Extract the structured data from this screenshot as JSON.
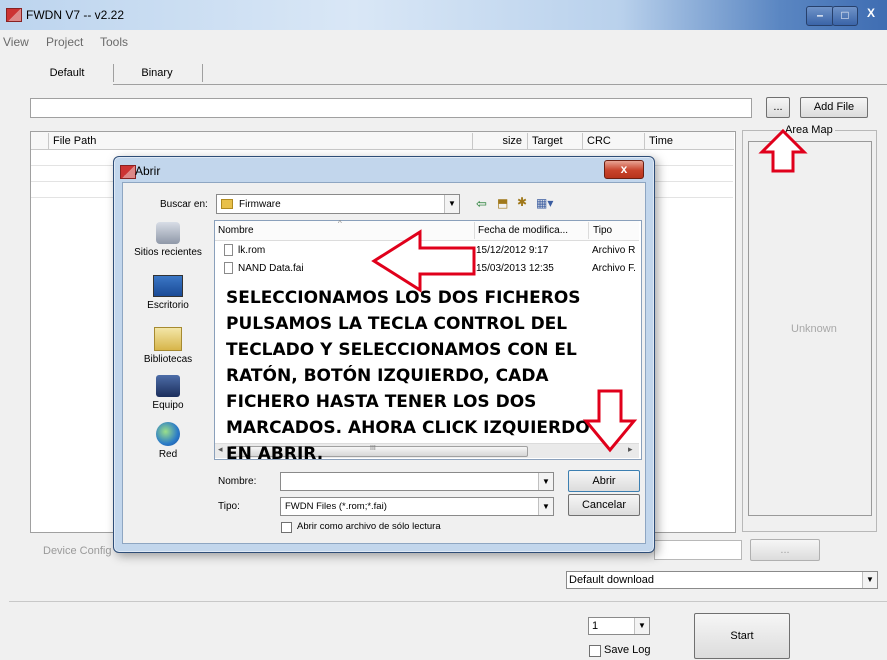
{
  "window": {
    "title": "FWDN V7 -- v2.22",
    "min": "–",
    "max": "□",
    "close": "X"
  },
  "menu": [
    "View",
    "Project",
    "Tools"
  ],
  "tabs": [
    {
      "label": "Default"
    },
    {
      "label": "Binary"
    }
  ],
  "toolbar": {
    "browse_label": "...",
    "add_file_label": "Add File"
  },
  "table": {
    "columns": [
      "File Path",
      "size",
      "Target",
      "CRC",
      "Time"
    ]
  },
  "area_map": {
    "title": "Area Map",
    "status": "Unknown"
  },
  "device_config": {
    "label": "Device Config",
    "button": "..."
  },
  "download_mode": {
    "value": "Default download"
  },
  "bottom": {
    "count": "1",
    "save_log": "Save Log",
    "start": "Start"
  },
  "dialog": {
    "title": "Abrir",
    "close": "x",
    "look_in_label": "Buscar en:",
    "look_in_value": "Firmware",
    "places": [
      {
        "label": "Sitios recientes",
        "icon": "recent-places-icon"
      },
      {
        "label": "Escritorio",
        "icon": "desktop-icon"
      },
      {
        "label": "Bibliotecas",
        "icon": "libraries-icon"
      },
      {
        "label": "Equipo",
        "icon": "computer-icon"
      },
      {
        "label": "Red",
        "icon": "network-icon"
      }
    ],
    "columns": [
      "Nombre",
      "Fecha de modifica...",
      "Tipo"
    ],
    "files": [
      {
        "name": "lk.rom",
        "date": "15/12/2012 9:17",
        "type": "Archivo R"
      },
      {
        "name": "NAND Data.fai",
        "date": "15/03/2013 12:35",
        "type": "Archivo F."
      }
    ],
    "filename_label": "Nombre:",
    "filetype_label": "Tipo:",
    "filetype_value": "FWDN Files (*.rom;*.fai)",
    "readonly_label": "Abrir como archivo de sólo lectura",
    "open_button": "Abrir",
    "cancel_button": "Cancelar",
    "scroll_mid": "III"
  },
  "annotation": {
    "lines": [
      "SELECCIONAMOS LOS DOS FICHEROS",
      "PULSAMOS LA TECLA CONTROL DEL",
      "TECLADO Y SELECCIONAMOS CON EL",
      "RATÓN, BOTÓN IZQUIERDO, CADA",
      "FICHERO HASTA TENER LOS DOS",
      "MARCADOS. AHORA CLICK IZQUIERDO",
      "EN ABRIR."
    ],
    "arrow_color": "#e0001b"
  }
}
